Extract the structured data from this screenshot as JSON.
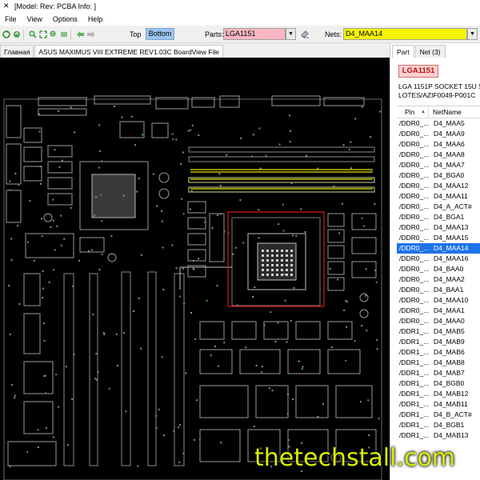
{
  "window": {
    "title": "[Model: Rev:  PCBA Info: ]",
    "icon": "tools-icon"
  },
  "menu": [
    "File",
    "View",
    "Options",
    "Help"
  ],
  "toolbar": {
    "side_top": "Top",
    "side_bottom": "Bottom",
    "parts_label": "Parts:",
    "parts_value": "LGA1151",
    "nets_label": "Nets:",
    "nets_value": "D4_MAA14",
    "parts_color": "#f7b6c2",
    "nets_color": "#f5f500"
  },
  "doc_tabs": [
    "Главная",
    "ASUS MAXIMUS VIII EXTREME REV1.03C BoardView File"
  ],
  "panel": {
    "tabs": [
      "Part",
      "Net (3)"
    ],
    "part_name": "LGA1151",
    "part_desc_1": "LGA 1151P SOCKET 15U S",
    "part_desc_2": "LOTES/AZIF0049-P001C",
    "columns": [
      "Pin",
      "NetName"
    ],
    "rows": [
      {
        "pin": "/DDR0_...",
        "net": "D4_MAA5"
      },
      {
        "pin": "/DDR0_...",
        "net": "D4_MAA9"
      },
      {
        "pin": "/DDR0_...",
        "net": "D4_MAA6"
      },
      {
        "pin": "/DDR0_...",
        "net": "D4_MAA8"
      },
      {
        "pin": "/DDR0_...",
        "net": "D4_MAA7"
      },
      {
        "pin": "/DDR0_...",
        "net": "D4_BGA0"
      },
      {
        "pin": "/DDR0_...",
        "net": "D4_MAA12"
      },
      {
        "pin": "/DDR0_...",
        "net": "D4_MAA11"
      },
      {
        "pin": "/DDR0_...",
        "net": "D4_A_ACT#"
      },
      {
        "pin": "/DDR0_...",
        "net": "D4_BGA1"
      },
      {
        "pin": "/DDR0_...",
        "net": "D4_MAA13"
      },
      {
        "pin": "/DDR0_...",
        "net": "D4_MAA15"
      },
      {
        "pin": "/DDR0_...",
        "net": "D4_MAA14",
        "selected": true
      },
      {
        "pin": "/DDR0_...",
        "net": "D4_MAA16"
      },
      {
        "pin": "/DDR0_...",
        "net": "D4_BAA0"
      },
      {
        "pin": "/DDR0_...",
        "net": "D4_MAA2"
      },
      {
        "pin": "/DDR0_...",
        "net": "D4_BAA1"
      },
      {
        "pin": "/DDR0_...",
        "net": "D4_MAA10"
      },
      {
        "pin": "/DDR0_...",
        "net": "D4_MAA1"
      },
      {
        "pin": "/DDR0_...",
        "net": "D4_MAA0"
      },
      {
        "pin": "/DDR1_...",
        "net": "D4_MAB5"
      },
      {
        "pin": "/DDR1_...",
        "net": "D4_MAB9"
      },
      {
        "pin": "/DDR1_...",
        "net": "D4_MAB6"
      },
      {
        "pin": "/DDR1_...",
        "net": "D4_MAB8"
      },
      {
        "pin": "/DDR1_...",
        "net": "D4_MAB7"
      },
      {
        "pin": "/DDR1_...",
        "net": "D4_BGB0"
      },
      {
        "pin": "/DDR1_...",
        "net": "D4_MAB12"
      },
      {
        "pin": "/DDR1_...",
        "net": "D4_MAB11"
      },
      {
        "pin": "/DDR1_...",
        "net": "D4_B_ACT#"
      },
      {
        "pin": "/DDR1_...",
        "net": "D4_BGB1"
      },
      {
        "pin": "/DDR1_...",
        "net": "D4_MAB13"
      }
    ]
  },
  "watermark": "thetechstall.com"
}
